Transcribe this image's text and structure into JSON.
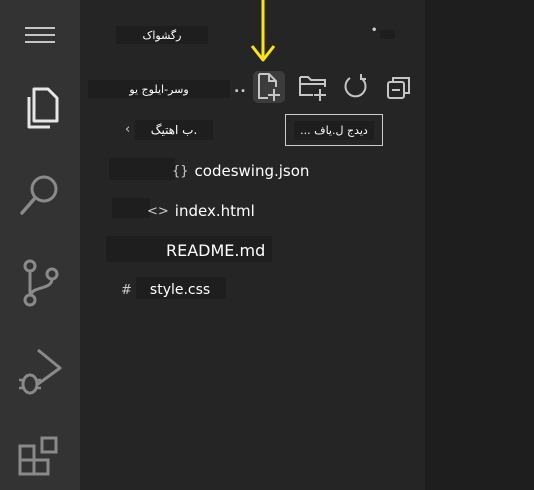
{
  "explorer": {
    "header_label": "رگشواک",
    "more_dots": "•",
    "section_title": "وسر-ایلوج یو",
    "section_dots": "..",
    "folder_label": "ب اهتیگ.",
    "folder_chevron": "‹"
  },
  "toolbar": {
    "new_file_tooltip": "... دیدج ل.یاف"
  },
  "files": [
    {
      "icon": "{}",
      "name": "codeswing.json"
    },
    {
      "icon": "<>",
      "name": "index.html"
    },
    {
      "icon": "",
      "name": "README.md"
    },
    {
      "icon": "#",
      "name": "style.css"
    }
  ],
  "colors": {
    "activity_bar": "#333333",
    "sidebar": "#252526",
    "editor": "#1e1e1e",
    "arrow": "#ffe600",
    "icon": "#c5c5c5"
  }
}
